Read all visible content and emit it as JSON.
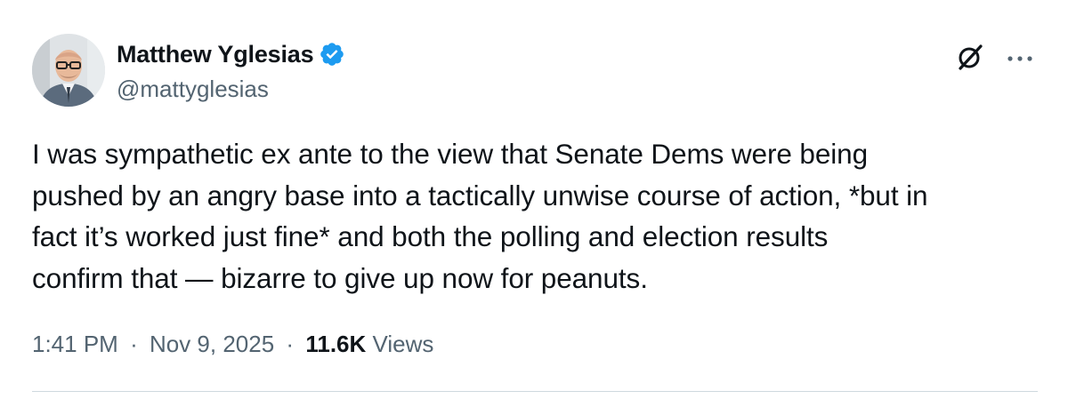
{
  "author": {
    "display_name": "Matthew Yglesias",
    "handle": "@mattyglesias",
    "verified": true,
    "verified_color": "#1d9bf0"
  },
  "icons": {
    "verified": "verified-badge-icon",
    "grok": "grok-icon",
    "more": "more-options-icon"
  },
  "tweet": {
    "lines": [
      "I was sympathetic ex ante to the view that Senate Dems were being",
      "pushed by an angry base into a tactically unwise course of action, *but in",
      "fact it’s worked just fine* and both the polling and election results",
      "confirm that — bizarre to give up now for peanuts."
    ]
  },
  "meta": {
    "time": "1:41 PM",
    "separator": "·",
    "date": "Nov 9, 2025",
    "views_count": "11.6K",
    "views_label": "Views"
  },
  "colors": {
    "text_primary": "#0f1419",
    "text_secondary": "#536471",
    "divider": "#cfd9de"
  }
}
